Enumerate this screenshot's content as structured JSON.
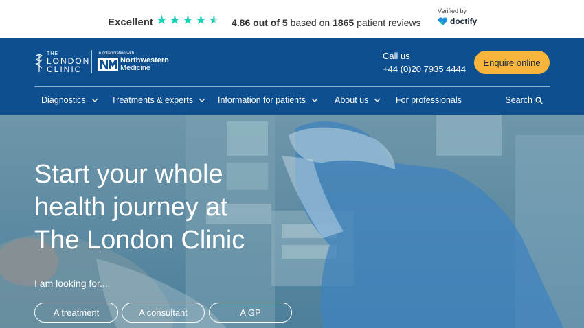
{
  "review_bar": {
    "excellent": "Excellent",
    "stars_shown": 4.5,
    "score": "4.86 out of 5",
    "based_on": "based on",
    "review_count": "1865",
    "reviews_label": "patient reviews",
    "verified_by": "Verified by",
    "verifier": "doctify",
    "star_color": "#1ccfb5"
  },
  "header": {
    "logo_line1": "THE",
    "logo_line2": "LONDON",
    "logo_line3": "CLINIC",
    "collab": "In collaboration with",
    "partner_line1": "Northwestern",
    "partner_line2": "Medicine",
    "call_label": "Call us",
    "phone": "+44 (0)20 7935 4444",
    "enquire_label": "Enquire online",
    "bg_color": "#0d4f8f",
    "accent": "#f7b53b"
  },
  "nav": {
    "items": [
      {
        "label": "Diagnostics",
        "has_dropdown": true
      },
      {
        "label": "Treatments & experts",
        "has_dropdown": true
      },
      {
        "label": "Information for patients",
        "has_dropdown": true
      },
      {
        "label": "About us",
        "has_dropdown": true
      },
      {
        "label": "For professionals",
        "has_dropdown": false
      }
    ],
    "search_label": "Search"
  },
  "hero": {
    "title_lines": [
      "Start your whole",
      "health journey at",
      "The London Clinic"
    ],
    "looking_for": "I am looking for...",
    "buttons": [
      {
        "label": "A treatment"
      },
      {
        "label": "A consultant"
      },
      {
        "label": "A GP"
      }
    ]
  }
}
